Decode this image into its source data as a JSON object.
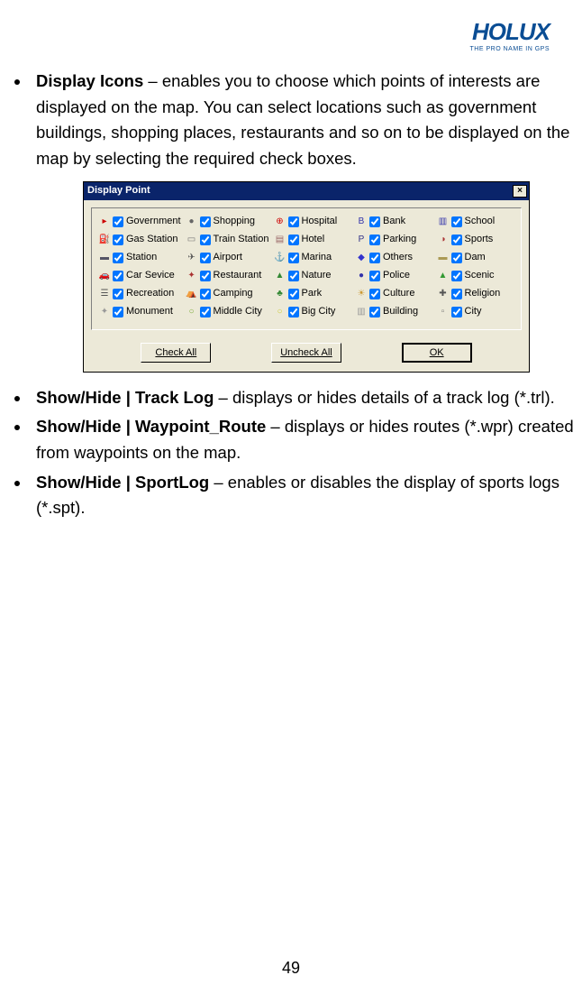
{
  "logo": {
    "main": "HOLUX",
    "sub": "THE PRO NAME IN GPS"
  },
  "bullets": [
    {
      "bold": "Display Icons",
      "rest": " – enables you to choose which points of interests are displayed on the map. You can select locations such as government buildings, shopping places, restaurants and so on to be displayed on the map by selecting the required check boxes."
    },
    {
      "bold": "Show/Hide | Track Log",
      "rest": " – displays or hides details of a track log (*.trl)."
    },
    {
      "bold": "Show/Hide | Waypoint_Route",
      "rest": " – displays or hides routes (*.wpr) created from waypoints on the map."
    },
    {
      "bold": "Show/Hide | SportLog",
      "rest": " – enables or disables the display of sports logs (*.spt)."
    }
  ],
  "dialog": {
    "title": "Display Point",
    "close": "×",
    "buttons": {
      "check": "Check All",
      "uncheck": "Uncheck All",
      "ok": "OK"
    },
    "items": [
      {
        "label": "Government",
        "glyph": "▸",
        "color": "#c00"
      },
      {
        "label": "Shopping",
        "glyph": "●",
        "color": "#666"
      },
      {
        "label": "Hospital",
        "glyph": "⊕",
        "color": "#c00"
      },
      {
        "label": "Bank",
        "glyph": "B",
        "color": "#33a"
      },
      {
        "label": "School",
        "glyph": "▥",
        "color": "#33a"
      },
      {
        "label": "Gas Station",
        "glyph": "⛽",
        "color": "#c33"
      },
      {
        "label": "Train Station",
        "glyph": "▭",
        "color": "#777"
      },
      {
        "label": "Hotel",
        "glyph": "▤",
        "color": "#966"
      },
      {
        "label": "Parking",
        "glyph": "P",
        "color": "#338"
      },
      {
        "label": "Sports",
        "glyph": "◑",
        "color": "#a33"
      },
      {
        "label": "Station",
        "glyph": "▬",
        "color": "#556"
      },
      {
        "label": "Airport",
        "glyph": "✈",
        "color": "#555"
      },
      {
        "label": "Marina",
        "glyph": "⚓",
        "color": "#33a"
      },
      {
        "label": "Others",
        "glyph": "◆",
        "color": "#33c"
      },
      {
        "label": "Dam",
        "glyph": "▬",
        "color": "#a95"
      },
      {
        "label": "Car Sevice",
        "glyph": "🚗",
        "color": "#c33"
      },
      {
        "label": "Restaurant",
        "glyph": "✦",
        "color": "#a33"
      },
      {
        "label": "Nature",
        "glyph": "▲",
        "color": "#383"
      },
      {
        "label": "Police",
        "glyph": "●",
        "color": "#33a"
      },
      {
        "label": "Scenic",
        "glyph": "▲",
        "color": "#393"
      },
      {
        "label": "Recreation",
        "glyph": "☰",
        "color": "#555"
      },
      {
        "label": "Camping",
        "glyph": "⛺",
        "color": "#383"
      },
      {
        "label": "Park",
        "glyph": "♣",
        "color": "#383"
      },
      {
        "label": "Culture",
        "glyph": "☀",
        "color": "#c93"
      },
      {
        "label": "Religion",
        "glyph": "✚",
        "color": "#555"
      },
      {
        "label": "Monument",
        "glyph": "✦",
        "color": "#999"
      },
      {
        "label": "Middle City",
        "glyph": "○",
        "color": "#7a3"
      },
      {
        "label": "Big City",
        "glyph": "○",
        "color": "#cc3"
      },
      {
        "label": "Building",
        "glyph": "▥",
        "color": "#999"
      },
      {
        "label": "City",
        "glyph": "▫",
        "color": "#777"
      }
    ]
  },
  "page": "49"
}
